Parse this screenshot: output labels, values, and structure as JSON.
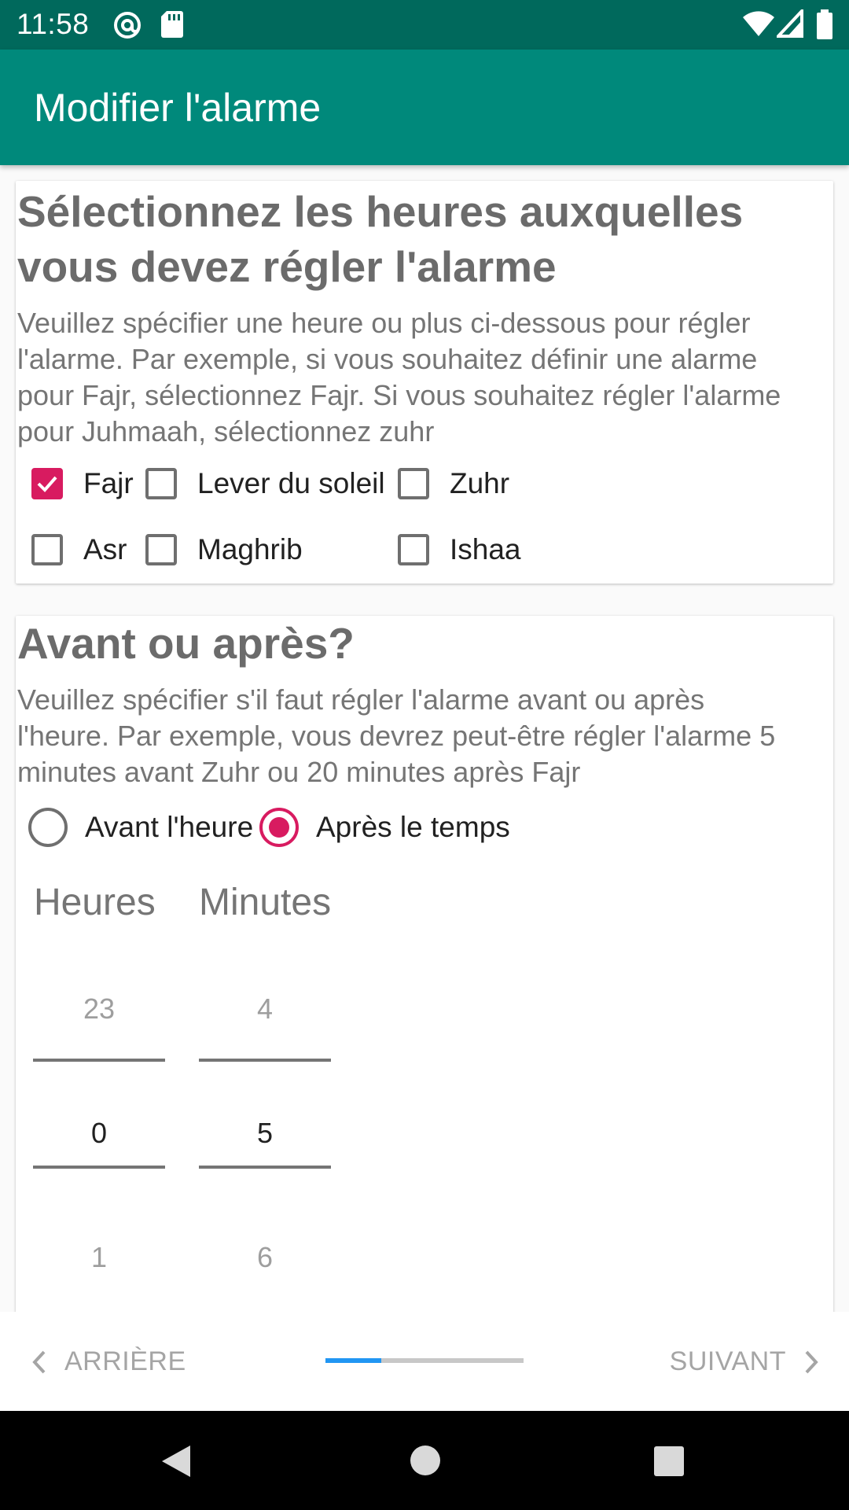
{
  "status_bar": {
    "time": "11:58",
    "icons": [
      "at-sign-icon",
      "sd-card-icon",
      "wifi-icon",
      "signal-icon",
      "battery-icon"
    ]
  },
  "app_bar": {
    "title": "Modifier l'alarme"
  },
  "section_prayers": {
    "heading_line1": "Sélectionnez les heures auxquelles",
    "heading_line2": "vous devez régler l'alarme",
    "desc_line1": "Veuillez spécifier une heure ou plus ci-dessous pour régler",
    "desc_line2": "l'alarme. Par exemple, si vous souhaitez définir une alarme",
    "desc_line3": "pour Fajr, sélectionnez Fajr. Si vous souhaitez régler l'alarme",
    "desc_line4": "pour Juhmaah, sélectionnez zuhr",
    "prayers": [
      {
        "label": "Fajr",
        "checked": true
      },
      {
        "label": "Lever du soleil",
        "checked": false
      },
      {
        "label": "Zuhr",
        "checked": false
      },
      {
        "label": "Asr",
        "checked": false
      },
      {
        "label": "Maghrib",
        "checked": false
      },
      {
        "label": "Ishaa",
        "checked": false
      }
    ]
  },
  "section_timing": {
    "heading": "Avant ou après?",
    "desc_line1": "Veuillez spécifier s'il faut régler l'alarme avant ou après",
    "desc_line2": "l'heure. Par exemple, vous devrez peut-être régler l'alarme 5",
    "desc_line3": "minutes avant Zuhr ou 20 minutes après Fajr",
    "options": [
      {
        "label": "Avant l'heure",
        "selected": false
      },
      {
        "label": "Après le temps",
        "selected": true
      }
    ],
    "hours_label": "Heures",
    "minutes_label": "Minutes",
    "hours_picker": {
      "prev": "23",
      "current": "0",
      "next": "1"
    },
    "minutes_picker": {
      "prev": "4",
      "current": "5",
      "next": "6"
    }
  },
  "bottom_nav": {
    "back_label": "ARRIÈRE",
    "next_label": "SUIVANT",
    "progress": 0.28
  },
  "colors": {
    "accent": "#d81b60",
    "primary": "#00897b",
    "primary_dark": "#00695c",
    "progress": "#2196f3"
  }
}
